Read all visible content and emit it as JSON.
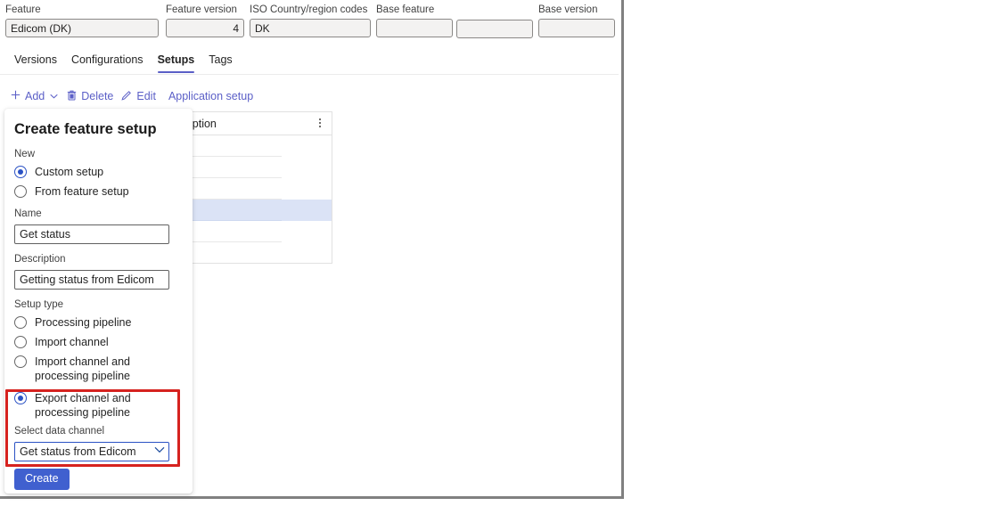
{
  "header": {
    "fields": [
      {
        "label": "Feature",
        "value": "Edicom (DK)",
        "align": "left"
      },
      {
        "label": "Feature version",
        "value": "4",
        "align": "right"
      },
      {
        "label": "ISO Country/region codes",
        "value": "DK",
        "align": "left"
      },
      {
        "label": "Base feature",
        "value": "",
        "align": "left"
      },
      {
        "label": "",
        "value": "",
        "align": "left"
      },
      {
        "label": "Base version",
        "value": "",
        "align": "left"
      }
    ]
  },
  "tabs": [
    {
      "label": "Versions",
      "active": false
    },
    {
      "label": "Configurations",
      "active": false
    },
    {
      "label": "Setups",
      "active": true
    },
    {
      "label": "Tags",
      "active": false
    }
  ],
  "command_bar": {
    "items": [
      {
        "label": "Add",
        "icon": "plus-icon",
        "glyph": "+",
        "has_chevron": true
      },
      {
        "label": "Delete",
        "icon": "trash-icon",
        "glyph": "Ὕ1",
        "has_chevron": false
      },
      {
        "label": "Edit",
        "icon": "pencil-icon",
        "glyph": "✎",
        "has_chevron": false
      },
      {
        "label": "Application setup",
        "icon": "",
        "glyph": "",
        "has_chevron": false
      }
    ]
  },
  "grid": {
    "column_header": "iption",
    "more_options": "⋮",
    "rows": [
      {
        "selected": false
      },
      {
        "selected": false
      },
      {
        "selected": false
      },
      {
        "selected": true
      },
      {
        "selected": false
      },
      {
        "selected": false
      }
    ]
  },
  "panel": {
    "title": "Create feature setup",
    "new_label": "New",
    "new_options": [
      {
        "label": "Custom setup",
        "selected": true
      },
      {
        "label": "From feature setup",
        "selected": false
      }
    ],
    "name_label": "Name",
    "name_value": "Get status",
    "description_label": "Description",
    "description_value": "Getting status from Edicom",
    "setup_type_label": "Setup type",
    "setup_type_options": [
      {
        "label": "Processing pipeline",
        "selected": false
      },
      {
        "label": "Import channel",
        "selected": false
      },
      {
        "label": "Import channel and processing pipeline",
        "selected": false
      },
      {
        "label": "Export channel and processing pipeline",
        "selected": true
      }
    ],
    "data_channel_label": "Select data channel",
    "data_channel_value": "Get status from Edicom",
    "create_label": "Create"
  },
  "colors": {
    "accent": "#5b5fc7",
    "radio_selected": "#2b52c4",
    "create_button": "#4060cf",
    "highlight_box": "#d6221f",
    "row_selected": "#dbe3f6"
  }
}
